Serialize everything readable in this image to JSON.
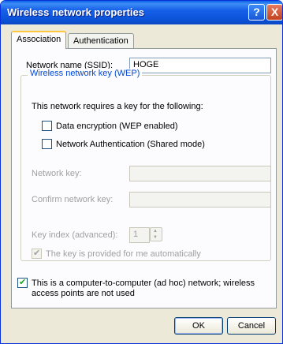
{
  "window": {
    "title": "Wireless network properties",
    "help_glyph": "?",
    "close_glyph": "X"
  },
  "tabs": [
    {
      "label": "Association",
      "active": true
    },
    {
      "label": "Authentication",
      "active": false
    }
  ],
  "association": {
    "ssid_label": "Network name (SSID):",
    "ssid_value": "HOGE",
    "wep_group_title": "Wireless network key (WEP)",
    "requires_text": "This network requires a key for the following:",
    "data_encryption": {
      "label": "Data encryption (WEP enabled)",
      "checked": false
    },
    "network_auth": {
      "label": "Network Authentication (Shared mode)",
      "checked": false
    },
    "network_key_label": "Network key:",
    "network_key_value": "",
    "confirm_key_label": "Confirm network key:",
    "confirm_key_value": "",
    "key_index_label": "Key index (advanced):",
    "key_index_value": "1",
    "auto_key": {
      "label": "The key is provided for me automatically",
      "checked": true
    },
    "adhoc": {
      "label_line1": "This is a computer-to-computer (ad hoc) network; wireless",
      "label_line2": "access points are not used",
      "checked": true
    }
  },
  "buttons": {
    "ok": "OK",
    "cancel": "Cancel"
  },
  "colors": {
    "titlebar": "#0a5fe8",
    "face": "#ece9d8",
    "group_title": "#0046d5"
  }
}
